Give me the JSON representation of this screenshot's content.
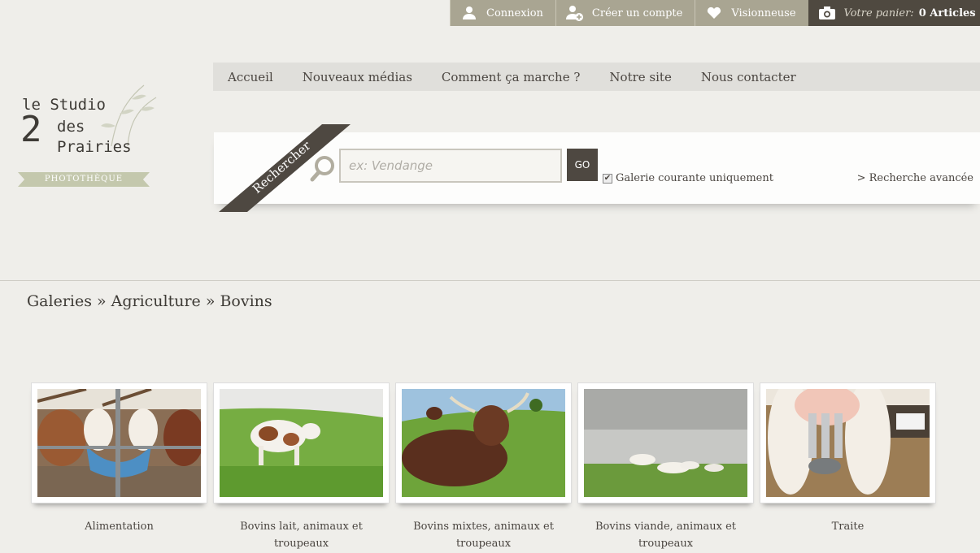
{
  "topbar": {
    "login": "Connexion",
    "register": "Créer un compte",
    "viewer": "Visionneuse",
    "cart_label": "Votre panier:",
    "cart_count": "0 Articles"
  },
  "logo": {
    "line1": "le Studio",
    "number": "2",
    "line2": "des",
    "line3": "Prairies",
    "ribbon": "PHOTOTHÈQUE"
  },
  "nav": {
    "items": [
      "Accueil",
      "Nouveaux médias",
      "Comment ça marche ?",
      "Notre site",
      "Nous contacter"
    ]
  },
  "search": {
    "ribbon_label": "Rechercher",
    "placeholder": "ex: Vendange",
    "go_label": "GO",
    "current_gallery_label": "Galerie courante uniquement",
    "current_gallery_checked": true,
    "advanced_label": "> Recherche avancée"
  },
  "breadcrumb": [
    "Galeries",
    "Agriculture",
    "Bovins"
  ],
  "gallery": [
    {
      "caption": "Alimentation",
      "icon": "cows-feeding-photo"
    },
    {
      "caption": "Bovins lait, animaux et troupeaux",
      "icon": "dairy-cow-photo"
    },
    {
      "caption": "Bovins mixtes, animaux et troupeaux",
      "icon": "bull-lying-photo"
    },
    {
      "caption": "Bovins viande, animaux et troupeaux",
      "icon": "herd-field-photo"
    },
    {
      "caption": "Traite",
      "icon": "milking-photo"
    }
  ]
}
